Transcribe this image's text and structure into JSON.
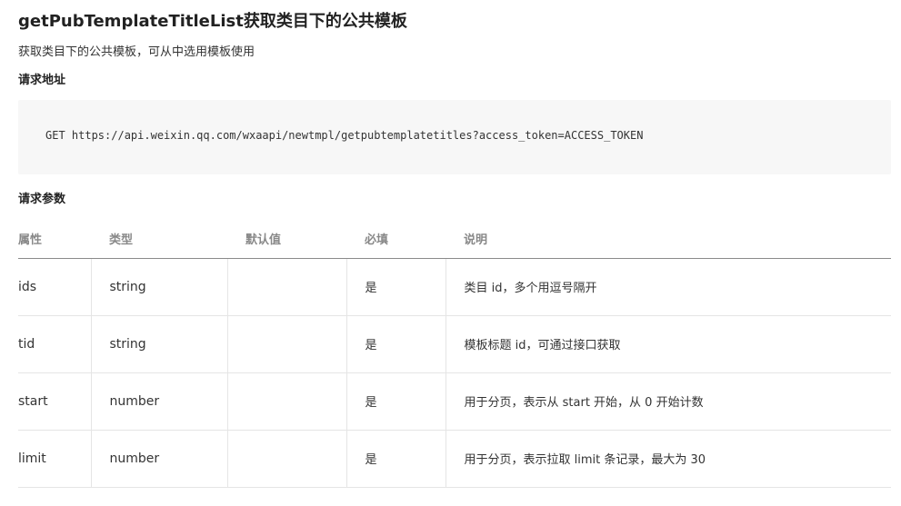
{
  "doc": {
    "title": "getPubTemplateTitleList获取类目下的公共模板",
    "description": "获取类目下的公共模板，可从中选用模板使用",
    "request_url_heading": "请求地址",
    "request_url_code": "GET https://api.weixin.qq.com/wxaapi/newtmpl/getpubtemplatetitles?access_token=ACCESS_TOKEN",
    "request_params_heading": "请求参数"
  },
  "table": {
    "headers": [
      "属性",
      "类型",
      "默认值",
      "必填",
      "说明"
    ],
    "rows": [
      {
        "attr": "ids",
        "type": "string",
        "default": "",
        "required": "是",
        "desc": "类目 id，多个用逗号隔开"
      },
      {
        "attr": "tid",
        "type": "string",
        "default": "",
        "required": "是",
        "desc": "模板标题 id，可通过接口获取"
      },
      {
        "attr": "start",
        "type": "number",
        "default": "",
        "required": "是",
        "desc": "用于分页，表示从 start 开始，从 0 开始计数"
      },
      {
        "attr": "limit",
        "type": "number",
        "default": "",
        "required": "是",
        "desc": "用于分页，表示拉取 limit 条记录，最大为 30"
      }
    ]
  }
}
